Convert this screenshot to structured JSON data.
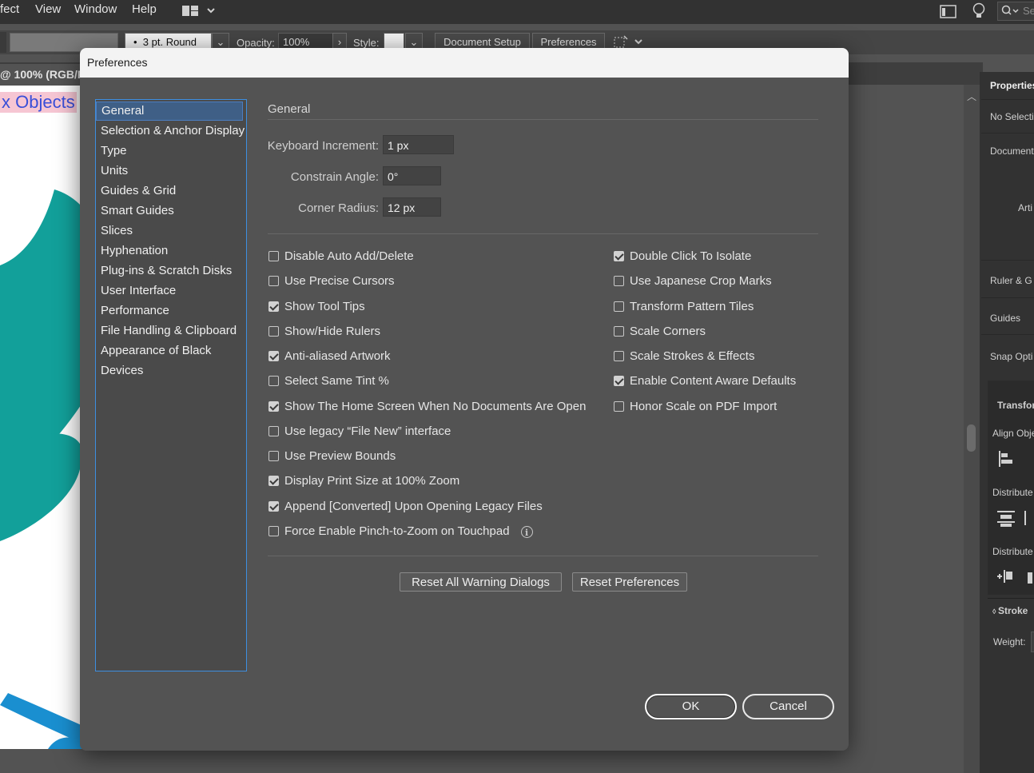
{
  "menubar": {
    "items": [
      "fect",
      "View",
      "Window",
      "Help"
    ],
    "search_placeholder": "Se"
  },
  "controlbar": {
    "stroke_profile": "3 pt. Round",
    "opacity_label": "Opacity:",
    "opacity_value": "100%",
    "style_label": "Style:",
    "document_setup": "Document Setup",
    "preferences": "Preferences"
  },
  "document": {
    "tab_title": "@ 100% (RGB/P",
    "artboard_text": "x Objects"
  },
  "right_panel": {
    "title": "Properties",
    "no_selection": "No Selecti",
    "document": "Document",
    "artboard": "Arti",
    "ruler": "Ruler & G",
    "guides": "Guides",
    "snap": "Snap Opti",
    "transform": "Transfor",
    "align_objects": "Align Obje",
    "distribute1": "Distribute",
    "distribute2": "Distribute",
    "stroke": "Stroke",
    "weight": "Weight:"
  },
  "dialog": {
    "title": "Preferences",
    "categories": [
      "General",
      "Selection & Anchor Display",
      "Type",
      "Units",
      "Guides & Grid",
      "Smart Guides",
      "Slices",
      "Hyphenation",
      "Plug-ins & Scratch Disks",
      "User Interface",
      "Performance",
      "File Handling & Clipboard",
      "Appearance of Black",
      "Devices"
    ],
    "section_title": "General",
    "fields": {
      "keyboard_increment": {
        "label": "Keyboard Increment:",
        "value": "1 px"
      },
      "constrain_angle": {
        "label": "Constrain Angle:",
        "value": "0°"
      },
      "corner_radius": {
        "label": "Corner Radius:",
        "value": "12 px"
      }
    },
    "left_options": [
      {
        "label": "Disable Auto Add/Delete",
        "checked": false
      },
      {
        "label": "Use Precise Cursors",
        "checked": false
      },
      {
        "label": "Show Tool Tips",
        "checked": true
      },
      {
        "label": "Show/Hide Rulers",
        "checked": false
      },
      {
        "label": "Anti-aliased Artwork",
        "checked": true
      },
      {
        "label": "Select Same Tint %",
        "checked": false
      },
      {
        "label": "Show The Home Screen When No Documents Are Open",
        "checked": true
      },
      {
        "label": "Use legacy “File New” interface",
        "checked": false
      },
      {
        "label": "Use Preview Bounds",
        "checked": false
      },
      {
        "label": "Display Print Size at 100% Zoom",
        "checked": true
      },
      {
        "label": "Append [Converted] Upon Opening Legacy Files",
        "checked": true
      },
      {
        "label": "Force Enable Pinch-to-Zoom on Touchpad",
        "checked": false
      }
    ],
    "right_options": [
      {
        "label": "Double Click To Isolate",
        "checked": true
      },
      {
        "label": "Use Japanese Crop Marks",
        "checked": false
      },
      {
        "label": "Transform Pattern Tiles",
        "checked": false
      },
      {
        "label": "Scale Corners",
        "checked": false
      },
      {
        "label": "Scale Strokes & Effects",
        "checked": false
      },
      {
        "label": "Enable Content Aware Defaults",
        "checked": true
      },
      {
        "label": "Honor Scale on PDF Import",
        "checked": false
      }
    ],
    "reset_warning_dialogs": "Reset All Warning Dialogs",
    "reset_preferences": "Reset Preferences",
    "ok": "OK",
    "cancel": "Cancel"
  }
}
